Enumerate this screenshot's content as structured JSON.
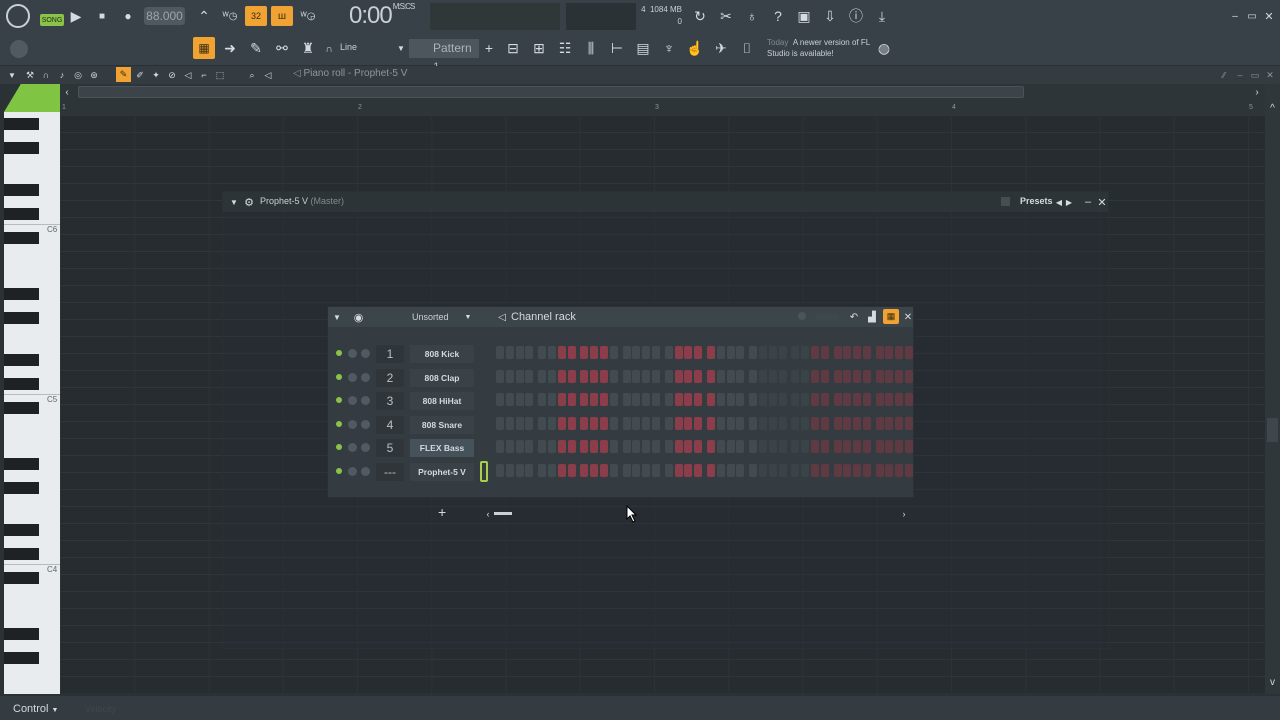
{
  "transport": {
    "song_label": "SONG",
    "tempo": "88.000",
    "time": "0:00",
    "time_unit": "M:S:CS",
    "beats": "32"
  },
  "cpu": {
    "poly": "4",
    "mem": "1084 MB",
    "voices": "0"
  },
  "toolbar": {
    "snap": "Line",
    "pattern": "Pattern 1"
  },
  "news": {
    "when": "Today",
    "text": "A newer version of FL Studio is available!"
  },
  "piano_roll": {
    "title": "Piano roll - Prophet-5 V",
    "bars": [
      "1",
      "2",
      "3",
      "4",
      "5"
    ],
    "octaves": [
      "C6",
      "C5",
      "C4"
    ]
  },
  "plugin": {
    "title": "Prophet-5 V",
    "subtitle": "(Master)",
    "presets": "Presets"
  },
  "rack": {
    "filter": "Unsorted",
    "title": "Channel rack",
    "channels": [
      {
        "num": "1",
        "name": "808 Kick"
      },
      {
        "num": "2",
        "name": "808 Clap"
      },
      {
        "num": "3",
        "name": "808 HiHat"
      },
      {
        "num": "4",
        "name": "808 Snare"
      },
      {
        "num": "5",
        "name": "FLEX Bass"
      },
      {
        "num": "---",
        "name": "Prophet-5 V"
      }
    ]
  },
  "bottom": {
    "control": "Control",
    "velocity": "Velocity"
  }
}
